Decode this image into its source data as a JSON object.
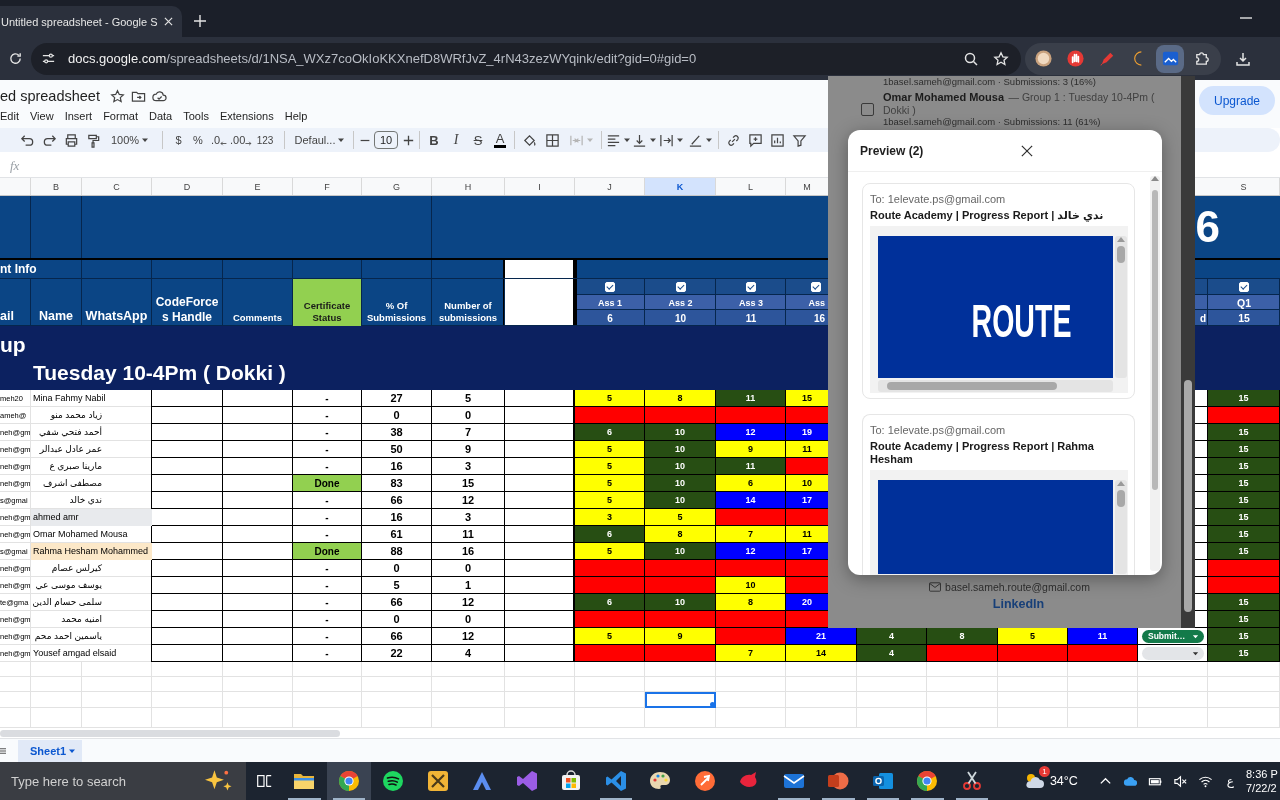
{
  "browser": {
    "tabs": [
      {
        "title": "Untitled spreadsheet - Google S",
        "selected": true
      }
    ],
    "url": {
      "host": "docs.google.com",
      "path": "/spreadsheets/d/1NSA_WXz7coOkIoKKXnefD8WRfJvZ_4rN43zezWYqink/edit?gid=0#gid=0"
    },
    "extensions": [
      {
        "selected": false
      },
      {
        "selected": false
      },
      {
        "selected": false
      },
      {
        "selected": false
      },
      {
        "selected": true
      },
      {
        "selected": false
      }
    ]
  },
  "doc": {
    "title": "ed spreadsheet",
    "menu": [
      "Edit",
      "View",
      "Insert",
      "Format",
      "Data",
      "Tools",
      "Extensions",
      "Help"
    ],
    "upgrade": "Upgrade"
  },
  "toolbar": {
    "zoom": "100%",
    "currency": "$",
    "percent": "%",
    "decrease_decimals": ".0",
    "increase_decimals": ".00",
    "number_format": "123",
    "font": "Defaul...",
    "font_size": "10",
    "bold": "B",
    "italic": "I",
    "strikethrough": "S",
    "text_color": "A",
    "merge_disabled": true
  },
  "formula_bar": {
    "label": "fx"
  },
  "sheet": {
    "columns_left": [
      {
        "label": "B",
        "selected": false
      },
      {
        "label": "C",
        "selected": false
      },
      {
        "label": "D",
        "selected": false
      },
      {
        "label": "E",
        "selected": false
      },
      {
        "label": "F",
        "selected": false
      },
      {
        "label": "G",
        "selected": false
      },
      {
        "label": "H",
        "selected": false
      },
      {
        "label": "I",
        "selected": false
      },
      {
        "label": "J",
        "selected": false
      },
      {
        "label": "K",
        "selected": true
      },
      {
        "label": "L",
        "selected": false
      },
      {
        "label": "M",
        "selected": false
      }
    ],
    "columns_right": [
      {
        "label": "S",
        "selected": false
      }
    ],
    "title_fragment": "6",
    "section_label": "nt Info",
    "headers": {
      "email": "ail",
      "name": "Name",
      "whatsapp": "WhatsApp",
      "codeforces": "CodeForces Handle",
      "comments": "Comments",
      "certificate": "Certificate Status",
      "percent": "% Of Submissions",
      "count": "Number of submissions"
    },
    "assignments": [
      {
        "name": "Ass 1",
        "max": "6",
        "checked": true
      },
      {
        "name": "Ass 2",
        "max": "10",
        "checked": true
      },
      {
        "name": "Ass 3",
        "max": "11",
        "checked": true
      },
      {
        "name": "Ass",
        "max": "16",
        "checked": true
      }
    ],
    "right_header_fragment": "d",
    "quiz": {
      "name": "Q1",
      "max": "15",
      "checked": true
    },
    "group": {
      "prefix": "up",
      "title": "Tuesday 10-4Pm ( Dokki )"
    },
    "rows": [
      {
        "email": "meh20",
        "name": {
          "text": "Mina Fahmy Nabil"
        },
        "certificate": {
          "text": "-"
        },
        "percent": "27",
        "count": "5",
        "scores": [
          {
            "value": "5",
            "color": "#ffff00"
          },
          {
            "value": "8",
            "color": "#ffff00"
          },
          {
            "value": "11",
            "color": "#274e13"
          },
          {
            "value": "15",
            "color": "#ffff00"
          }
        ],
        "q1": {
          "value": "15",
          "color": "#274e13"
        }
      },
      {
        "email": "ameh@",
        "name": {
          "text": "زياد محمد منو"
        },
        "certificate": {
          "text": "-"
        },
        "percent": "0",
        "count": "0",
        "scores": [
          {
            "color": "#ff0000"
          },
          {
            "color": "#ff0000"
          },
          {
            "color": "#ff0000"
          },
          {
            "color": "#ff0000"
          }
        ],
        "q1": {
          "color": "#ff0000"
        }
      },
      {
        "email": "neh@gm",
        "name": {
          "text": "أحمد فتحي شفي"
        },
        "certificate": {
          "text": "-"
        },
        "percent": "38",
        "count": "7",
        "scores": [
          {
            "value": "6",
            "color": "#274e13"
          },
          {
            "value": "10",
            "color": "#274e13"
          },
          {
            "value": "12",
            "color": "#0000ff"
          },
          {
            "value": "19",
            "color": "#0000ff"
          }
        ],
        "q1": {
          "value": "15",
          "color": "#274e13"
        }
      },
      {
        "email": "neh@gm",
        "name": {
          "text": "عمر عادل عبدالر"
        },
        "certificate": {
          "text": "-"
        },
        "percent": "50",
        "count": "9",
        "scores": [
          {
            "value": "5",
            "color": "#ffff00"
          },
          {
            "value": "10",
            "color": "#274e13"
          },
          {
            "value": "9",
            "color": "#ffff00"
          },
          {
            "value": "11",
            "color": "#ffff00"
          }
        ],
        "q1": {
          "value": "15",
          "color": "#274e13"
        }
      },
      {
        "email": "neh@gm",
        "name": {
          "text": "مارينا صبري ع"
        },
        "certificate": {
          "text": "-"
        },
        "percent": "16",
        "count": "3",
        "scores": [
          {
            "value": "5",
            "color": "#ffff00"
          },
          {
            "value": "10",
            "color": "#274e13"
          },
          {
            "value": "11",
            "color": "#274e13"
          },
          {
            "color": "#ff0000"
          }
        ],
        "q1": {
          "value": "15",
          "color": "#274e13"
        }
      },
      {
        "email": "neh@gm",
        "name": {
          "text": "مصطفى اشرف"
        },
        "certificate": {
          "text": "Done",
          "color": "#92d050"
        },
        "percent": "83",
        "count": "15",
        "scores": [
          {
            "value": "5",
            "color": "#ffff00"
          },
          {
            "value": "10",
            "color": "#274e13"
          },
          {
            "value": "6",
            "color": "#ffff00"
          },
          {
            "value": "10",
            "color": "#ffff00"
          }
        ],
        "q1": {
          "value": "15",
          "color": "#274e13"
        }
      },
      {
        "email": "s@gmai",
        "name": {
          "text": "ندي خالد"
        },
        "certificate": {
          "text": "-"
        },
        "percent": "66",
        "count": "12",
        "scores": [
          {
            "value": "5",
            "color": "#ffff00"
          },
          {
            "value": "10",
            "color": "#274e13"
          },
          {
            "value": "14",
            "color": "#0000ff"
          },
          {
            "value": "17",
            "color": "#0000ff"
          }
        ],
        "q1": {
          "value": "15",
          "color": "#274e13"
        }
      },
      {
        "email": "neh@gm",
        "name": {
          "text": "ahmed amr",
          "color": "#e8eaed"
        },
        "certificate": {
          "text": "-"
        },
        "percent": "16",
        "count": "3",
        "scores": [
          {
            "value": "3",
            "color": "#ffff00"
          },
          {
            "value": "5",
            "color": "#ffff00"
          },
          {
            "color": "#ff0000"
          },
          {
            "color": "#ff0000"
          }
        ],
        "q1": {
          "value": "15",
          "color": "#274e13"
        }
      },
      {
        "email": "neh@gm",
        "name": {
          "text": "Omar Mohamed Mousa"
        },
        "certificate": {
          "text": "-"
        },
        "percent": "61",
        "count": "11",
        "scores": [
          {
            "value": "6",
            "color": "#274e13"
          },
          {
            "value": "8",
            "color": "#ffff00"
          },
          {
            "value": "7",
            "color": "#ffff00"
          },
          {
            "value": "11",
            "color": "#ffff00"
          }
        ],
        "q1": {
          "value": "15",
          "color": "#274e13"
        }
      },
      {
        "email": "s@gmai",
        "name": {
          "text": "Rahma Hesham Mohammed",
          "color": "#fce8c8"
        },
        "certificate": {
          "text": "Done",
          "color": "#92d050"
        },
        "percent": "88",
        "count": "16",
        "scores": [
          {
            "value": "5",
            "color": "#ffff00"
          },
          {
            "value": "10",
            "color": "#274e13"
          },
          {
            "value": "12",
            "color": "#0000ff"
          },
          {
            "value": "17",
            "color": "#0000ff"
          }
        ],
        "q1": {
          "value": "15",
          "color": "#274e13"
        }
      },
      {
        "email": "neh@gm",
        "name": {
          "text": "كيرلس عصام"
        },
        "certificate": {
          "text": "-"
        },
        "percent": "0",
        "count": "0",
        "scores": [
          {
            "color": "#ff0000"
          },
          {
            "color": "#ff0000"
          },
          {
            "color": "#ff0000"
          },
          {
            "color": "#ff0000"
          }
        ],
        "q1": {
          "color": "#ff0000"
        }
      },
      {
        "email": "neh@gm",
        "name": {
          "text": "يوسف موسى عي"
        },
        "certificate": {
          "text": "-"
        },
        "percent": "5",
        "count": "1",
        "scores": [
          {
            "color": "#ff0000"
          },
          {
            "color": "#ff0000"
          },
          {
            "value": "10",
            "color": "#ffff00"
          },
          {
            "color": "#ff0000"
          }
        ],
        "q1": {
          "color": "#ff0000"
        }
      },
      {
        "email": "te@gma",
        "name": {
          "text": "سلمى حسام الدين"
        },
        "certificate": {
          "text": "-"
        },
        "percent": "66",
        "count": "12",
        "scores": [
          {
            "value": "6",
            "color": "#274e13"
          },
          {
            "value": "10",
            "color": "#274e13"
          },
          {
            "value": "8",
            "color": "#ffff00"
          },
          {
            "value": "20",
            "color": "#0000ff"
          }
        ],
        "q1": {
          "value": "15",
          "color": "#274e13"
        }
      },
      {
        "email": "neh@gm",
        "name": {
          "text": "امنيه محمد"
        },
        "certificate": {
          "text": "-"
        },
        "percent": "0",
        "count": "0",
        "scores": [
          {
            "color": "#ff0000"
          },
          {
            "color": "#ff0000"
          },
          {
            "color": "#ff0000"
          },
          {
            "color": "#ff0000"
          }
        ],
        "q1": {
          "value": "15",
          "color": "#274e13"
        }
      },
      {
        "email": "neh@gm",
        "name": {
          "text": "ياسمين احمد محم"
        },
        "certificate": {
          "text": "-"
        },
        "percent": "66",
        "count": "12",
        "scores": [
          {
            "value": "5",
            "color": "#ffff00"
          },
          {
            "value": "9",
            "color": "#ffff00"
          },
          {
            "color": "#ff0000"
          },
          {
            "value": "21",
            "color": "#0000ff"
          },
          {
            "value": "4",
            "color": "#274e13"
          },
          {
            "value": "8",
            "color": "#274e13"
          },
          {
            "value": "5",
            "color": "#ffff00"
          },
          {
            "value": "11",
            "color": "#0000ff"
          }
        ],
        "status": {
          "label": "Submit…",
          "color": "#137a4a"
        },
        "q1": {
          "value": "15",
          "color": "#274e13"
        }
      },
      {
        "email": "neh@gm",
        "name": {
          "text": "Yousef amgad elsaid"
        },
        "certificate": {
          "text": "-"
        },
        "percent": "22",
        "count": "4",
        "scores": [
          {
            "color": "#ff0000"
          },
          {
            "color": "#ff0000"
          },
          {
            "value": "7",
            "color": "#ffff00"
          },
          {
            "value": "14",
            "color": "#ffff00"
          },
          {
            "value": "4",
            "color": "#274e13"
          },
          {
            "color": "#ff0000"
          },
          {
            "color": "#ff0000"
          },
          {
            "color": "#ff0000"
          }
        ],
        "status": {
          "color": "#e3e5e8"
        },
        "q1": {
          "value": "15",
          "color": "#274e13"
        }
      }
    ]
  },
  "panel": {
    "items": [
      {
        "summary": "1basel.sameh@gmail.com · Submissions: 3 (16%)"
      },
      {
        "name": "Omar Mohamed Mousa",
        "group": "— Group 1 : Tuesday 10-4Pm ( Dokki )",
        "summary": "1basel.sameh@gmail.com · Submissions: 11 (61%)",
        "checked": false
      }
    ],
    "contact_email": "basel.sameh.route@gmail.com",
    "link": "LinkedIn",
    "preview": {
      "title": "Preview (2)",
      "emails": [
        {
          "to": "To: 1elevate.ps@gmail.com",
          "subject": "Route Academy | Progress Report | ندي خالد",
          "logo": "ROUTE"
        },
        {
          "to": "To: 1elevate.ps@gmail.com",
          "subject": "Route Academy | Progress Report | Rahma Hesham"
        }
      ]
    }
  },
  "sheet_tabs": [
    {
      "label": "Sheet1",
      "selected": true
    }
  ],
  "taskbar": {
    "search_placeholder": "Type here to search",
    "apps": [
      {
        "running": true,
        "selected": false
      },
      {
        "running": true,
        "selected": true
      },
      {
        "running": false,
        "selected": false
      },
      {
        "running": false,
        "selected": false
      },
      {
        "running": false,
        "selected": false
      },
      {
        "running": false,
        "selected": false
      },
      {
        "running": false,
        "selected": false
      },
      {
        "running": true,
        "selected": false
      },
      {
        "running": false,
        "selected": false
      },
      {
        "running": false,
        "selected": false
      },
      {
        "running": false,
        "selected": false
      },
      {
        "running": true,
        "selected": false
      },
      {
        "running": true,
        "selected": false
      },
      {
        "running": true,
        "selected": false
      },
      {
        "running": true,
        "selected": false
      },
      {
        "running": true,
        "selected": false
      }
    ],
    "weather": {
      "badge": "1",
      "temperature": "34°C"
    },
    "language": "ع",
    "clock": {
      "time": "8:36 P",
      "date": "7/22/2"
    }
  }
}
